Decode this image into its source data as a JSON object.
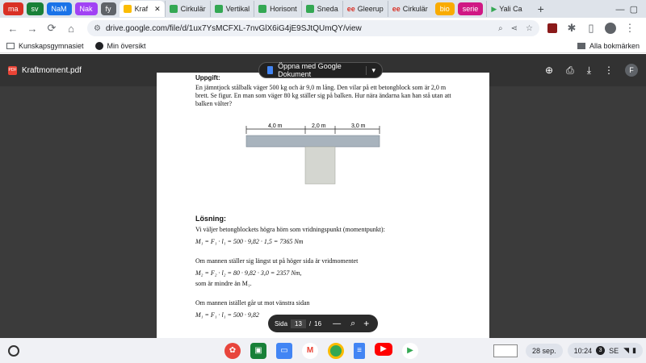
{
  "tabs": {
    "groups": [
      {
        "label": "ma",
        "color": "#d93025"
      },
      {
        "label": "sv",
        "color": "#188038"
      },
      {
        "label": "NaM",
        "color": "#1a73e8"
      },
      {
        "label": "Nak",
        "color": "#a142f4"
      },
      {
        "label": "fy",
        "color": "#5f6368"
      }
    ],
    "active": "Kraf",
    "others": [
      "Cirkulär",
      "Vertikal",
      "Horisont",
      "Sneda",
      "Gleerup",
      "Cirkulär"
    ],
    "group2": [
      {
        "label": "bio",
        "color": "#f9ab00"
      },
      {
        "label": "serie",
        "color": "#d01884"
      }
    ],
    "last": "Yali Ca"
  },
  "toolbar": {
    "url": "drive.google.com/file/d/1ux7YsMCFXL-7nvGlX6iG4jE9SJtQUmQY/view"
  },
  "bookmarks": {
    "items": [
      "Kunskapsgymnasiet",
      "Min översikt"
    ],
    "other": "Alla bokmärken"
  },
  "viewer": {
    "title": "Kraftmoment.pdf",
    "open_with": "Öppna med Google Dokument",
    "avatar": "F"
  },
  "doc": {
    "heading": "Uppgift:",
    "problem": "En jämntjock stålbalk väger 500 kg och är 9,0 m lång. Den vilar på ett betongblock som är 2,0 m brett. Se figur. En man som väger 80 kg ställer sig på balken. Hur nära ändarna kan han stå utan att balken välter?",
    "dims": [
      "4,0 m",
      "2,0 m",
      "3,0 m"
    ],
    "solution_heading": "Lösning:",
    "line1": "Vi väljer betongblockets högra hörn som  vridningspunkt (momentpunkt):",
    "eq1": "M₁ = F₁ · l₁ = 500 · 9,82 · 1,5 = 7365 Nm",
    "line2": "Om mannen ställer sig längst ut på höger sida är vridmomentet",
    "eq2": "M₂ = F₂ · l₂ = 80 · 9,82 · 3,0 = 2357 Nm,",
    "line3": "som är mindre än M₁.",
    "line4": "Om mannen istället går ut mot vänstra sidan",
    "eq3": "M₁ = F₁ · l₁ = 500 · 9,82"
  },
  "pager": {
    "label": "Sida",
    "current": "13",
    "sep": "/",
    "total": "16"
  },
  "shelf": {
    "date": "28 sep.",
    "time": "10:24",
    "badge": "3",
    "lang": "SE"
  }
}
